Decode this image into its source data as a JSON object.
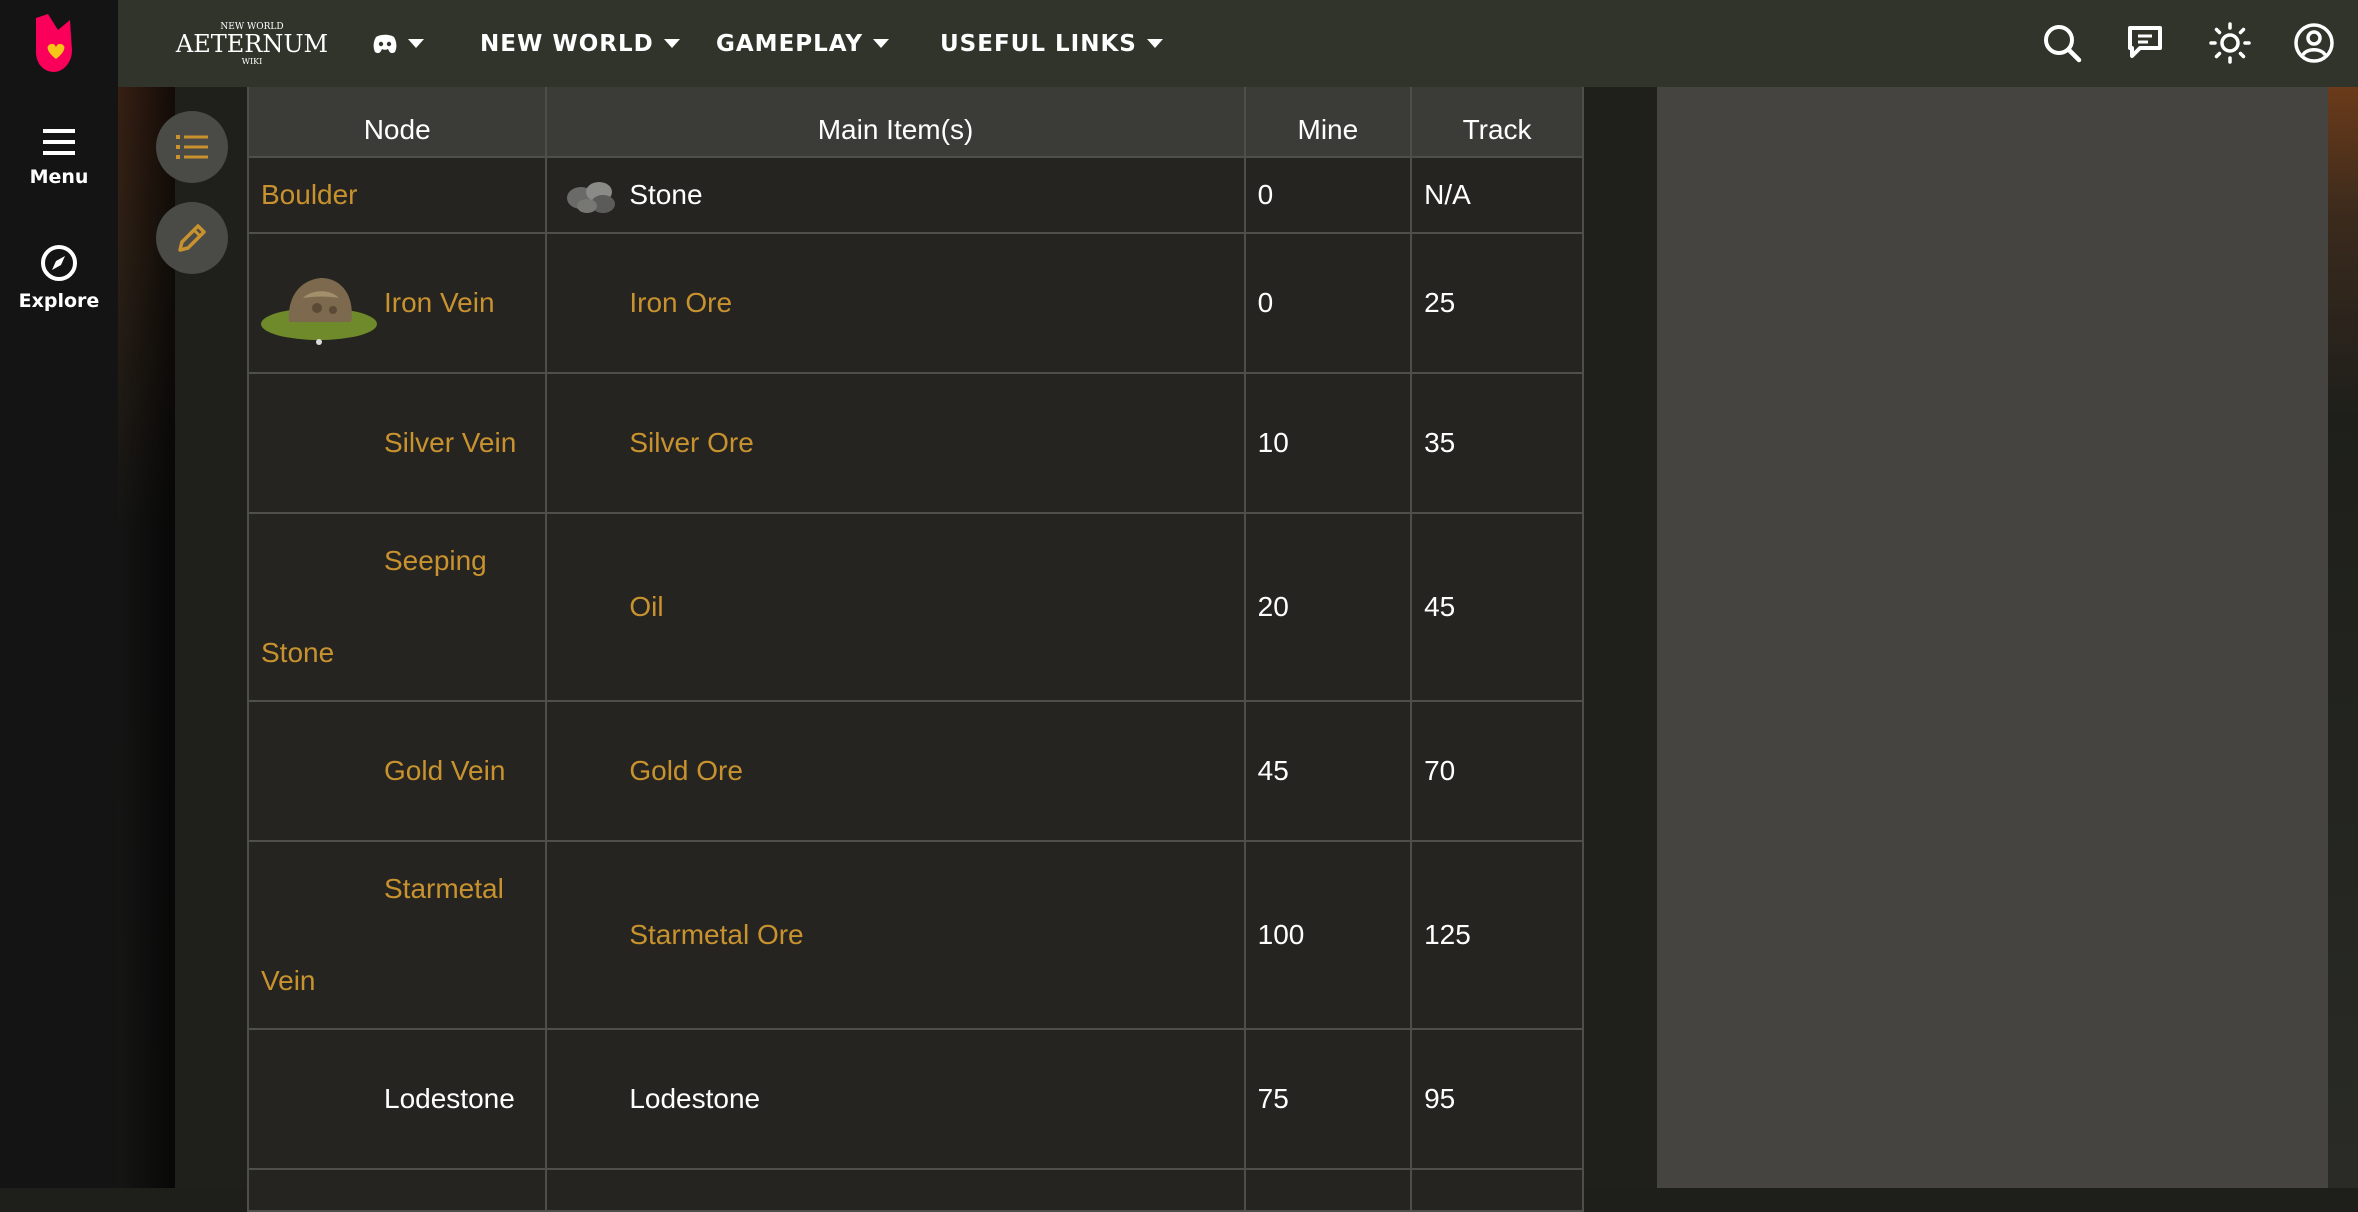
{
  "rail": {
    "menu_label": "Menu",
    "explore_label": "Explore"
  },
  "topbar": {
    "site_logo": {
      "top": "NEW WORLD",
      "main": "AETERNUM",
      "sub": "WIKI"
    },
    "nav": {
      "newworld": "NEW WORLD",
      "gameplay": "GAMEPLAY",
      "useful": "USEFUL LINKS"
    }
  },
  "table": {
    "headers": {
      "node": "Node",
      "item": "Main Item(s)",
      "mine": "Mine",
      "track": "Track"
    },
    "rows": [
      {
        "node": "Boulder",
        "item": "Stone",
        "mine": "0",
        "track": "N/A"
      },
      {
        "node": "Iron Vein",
        "item": "Iron Ore",
        "mine": "0",
        "track": "25"
      },
      {
        "node": "Silver Vein",
        "item": "Silver Ore",
        "mine": "10",
        "track": "35"
      },
      {
        "node_line1": "Seeping",
        "node_line2": "Stone",
        "item": "Oil",
        "mine": "20",
        "track": "45"
      },
      {
        "node": "Gold Vein",
        "item": "Gold Ore",
        "mine": "45",
        "track": "70"
      },
      {
        "node_line1": "Starmetal",
        "node_line2": "Vein",
        "item": "Starmetal Ore",
        "mine": "100",
        "track": "125"
      },
      {
        "node": "Lodestone",
        "item": "Lodestone",
        "mine": "75",
        "track": "95"
      }
    ]
  },
  "colors": {
    "link": "#c8922f",
    "topbar": "#30342b",
    "rail": "#141414",
    "brand": "#fa005a"
  }
}
